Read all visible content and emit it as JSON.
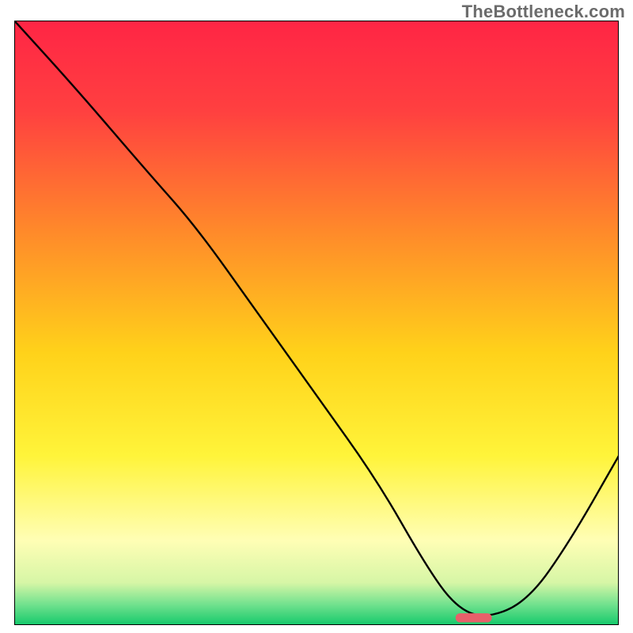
{
  "watermark": "TheBottleneck.com",
  "chart_data": {
    "type": "line",
    "title": "",
    "xlabel": "",
    "ylabel": "",
    "xlim": [
      0,
      100
    ],
    "ylim": [
      0,
      100
    ],
    "grid": false,
    "legend": false,
    "background_gradient_stops": [
      {
        "offset": 0.0,
        "color": "#ff2545"
      },
      {
        "offset": 0.15,
        "color": "#ff4040"
      },
      {
        "offset": 0.35,
        "color": "#ff8a2a"
      },
      {
        "offset": 0.55,
        "color": "#ffd21a"
      },
      {
        "offset": 0.72,
        "color": "#fff43a"
      },
      {
        "offset": 0.86,
        "color": "#fffeb5"
      },
      {
        "offset": 0.93,
        "color": "#d6f6a6"
      },
      {
        "offset": 0.965,
        "color": "#74e28f"
      },
      {
        "offset": 1.0,
        "color": "#14c96b"
      }
    ],
    "series": [
      {
        "name": "curve",
        "color": "#000000",
        "x": [
          0,
          10,
          22,
          30,
          40,
          50,
          60,
          68,
          73,
          78,
          85,
          92,
          100
        ],
        "y": [
          100,
          89,
          75,
          66,
          52,
          38,
          24,
          10,
          3,
          1,
          4,
          14,
          28
        ]
      }
    ],
    "marker": {
      "name": "highlight-pill",
      "color": "#e8606a",
      "x_center": 76,
      "y_center": 1.2,
      "width": 6,
      "height": 1.5
    }
  }
}
